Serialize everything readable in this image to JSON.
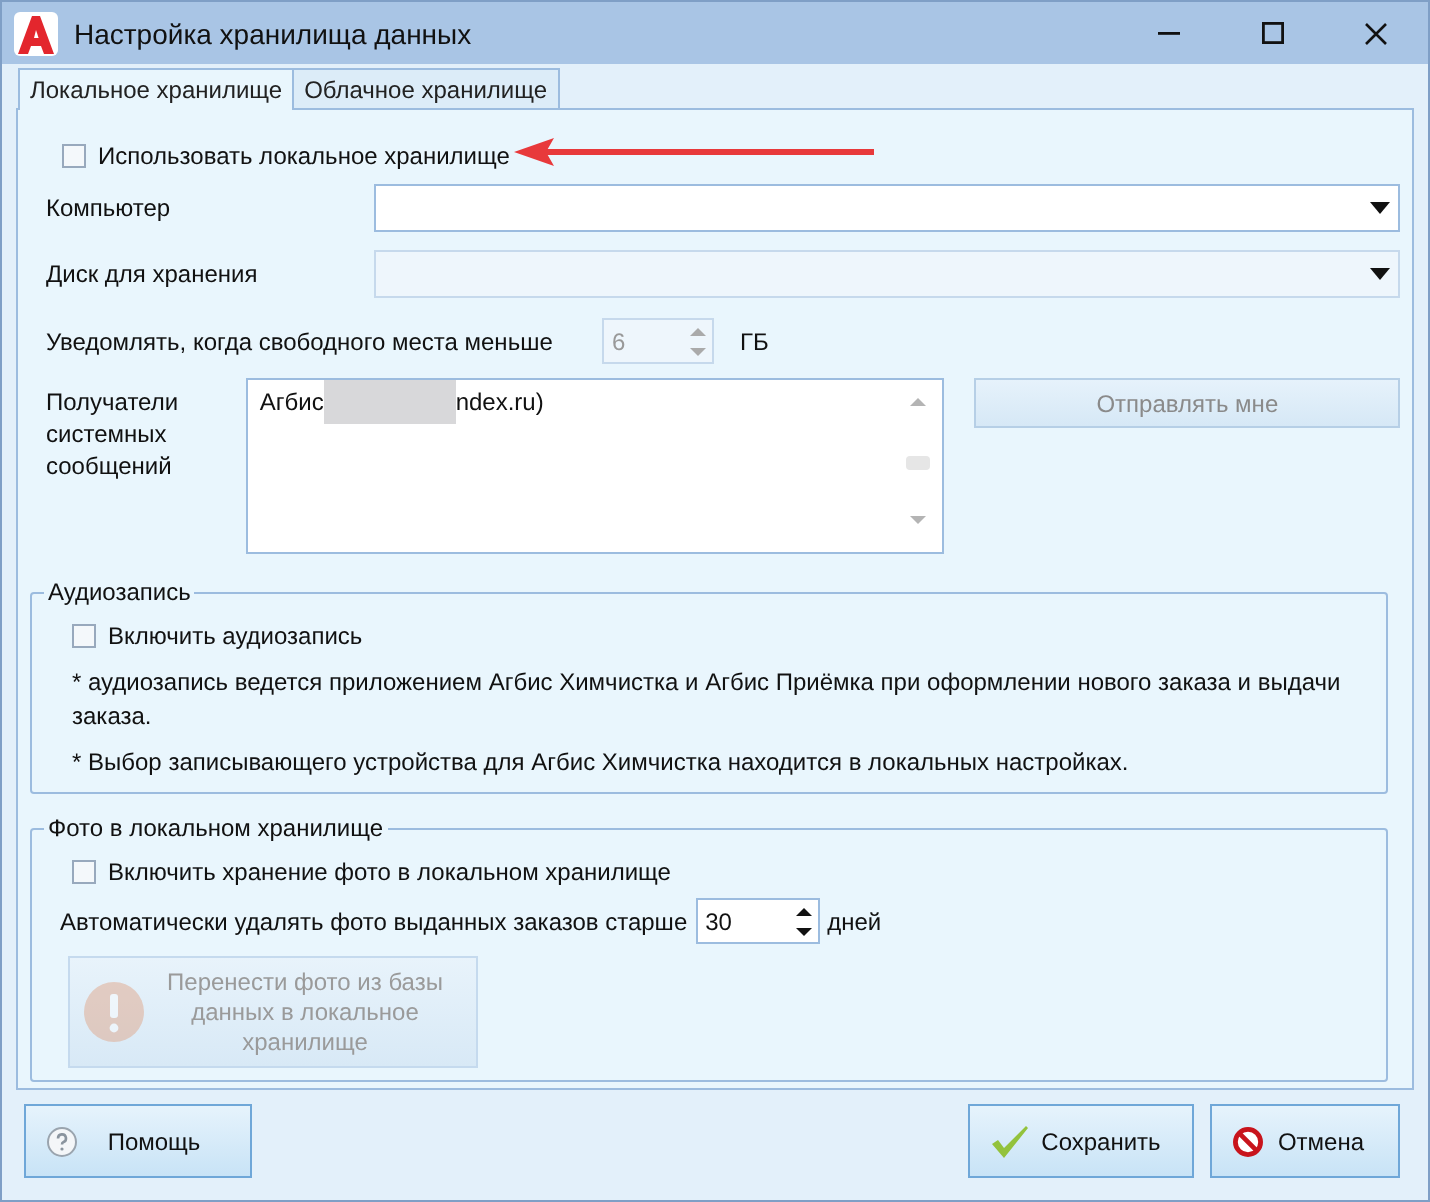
{
  "window": {
    "title": "Настройка хранилища данных"
  },
  "tabs": [
    {
      "label": "Локальное хранилище",
      "selected": true
    },
    {
      "label": "Облачное хранилище",
      "selected": false
    }
  ],
  "use_local": {
    "label": "Использовать локальное хранилище",
    "checked": false
  },
  "fields": [
    {
      "label": "Компьютер",
      "kind": "dropdown",
      "disabled": false
    },
    {
      "label": "Диск для хранения",
      "kind": "dropdown",
      "disabled": true
    }
  ],
  "notify": {
    "label": "Уведомлять, когда свободного места меньше",
    "value": "6",
    "unit": "ГБ",
    "disabled": true
  },
  "recipients": {
    "label": "Получатели системных сообщений",
    "items": [
      {
        "text_start": "Агбис",
        "text_end": "ndex.ru)"
      }
    ],
    "send_button": {
      "label": "Отправлять мне",
      "disabled": true
    }
  },
  "audio": {
    "title": "Аудиозапись",
    "checkbox": {
      "label": "Включить аудиозапись",
      "checked": false
    },
    "notes": [
      "* аудиозапись ведется приложением Агбис Химчистка и Агбис Приёмка при оформлении нового заказа и выдачи заказа.",
      "* Выбор записывающего устройства для Агбис Химчистка находится в локальных настройках."
    ]
  },
  "photo": {
    "title": "Фото в локальном хранилище",
    "checkbox": {
      "label": "Включить хранение фото в локальном хранилище",
      "checked": false
    },
    "auto_delete": {
      "label": "Автоматически удалять фото выданных заказов старше",
      "value": "30",
      "unit": "дней",
      "disabled": false
    },
    "transfer_button": {
      "label": "Перенести фото из базы данных в локальное хранилище",
      "disabled": true
    }
  },
  "buttons": [
    {
      "label": "Помощь",
      "kind": "help"
    },
    {
      "label": "Сохранить",
      "kind": "save"
    },
    {
      "label": "Отмена",
      "kind": "cancel"
    }
  ]
}
